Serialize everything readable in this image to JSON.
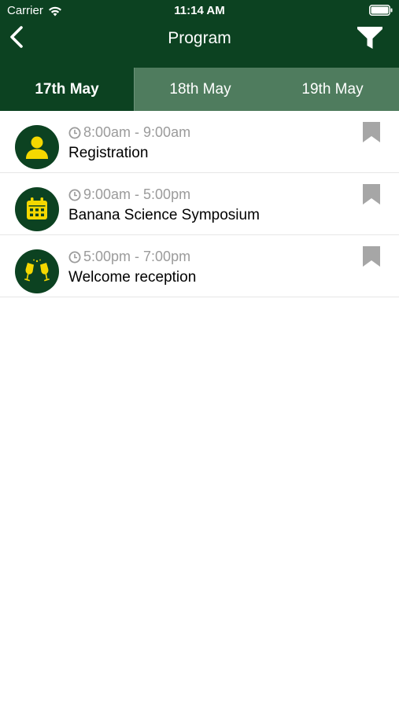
{
  "status_bar": {
    "carrier": "Carrier",
    "time": "11:14 AM"
  },
  "nav": {
    "title": "Program"
  },
  "tabs": [
    {
      "label": "17th May",
      "active": true
    },
    {
      "label": "18th May",
      "active": false
    },
    {
      "label": "19th May",
      "active": false
    }
  ],
  "events": [
    {
      "time": "8:00am - 9:00am",
      "title": "Registration",
      "icon": "person-icon",
      "bookmarked": false
    },
    {
      "time": "9:00am - 5:00pm",
      "title": "Banana Science Symposium",
      "icon": "calendar-icon",
      "bookmarked": false
    },
    {
      "time": "5:00pm - 7:00pm",
      "title": "Welcome reception",
      "icon": "champagne-glasses-icon",
      "bookmarked": false
    }
  ],
  "colors": {
    "header": "#0c4221",
    "tab_inactive": "#4f7c5e",
    "icon_accent": "#f5d800",
    "muted_text": "#9b9b9b",
    "bookmark": "#a6a6a6"
  }
}
